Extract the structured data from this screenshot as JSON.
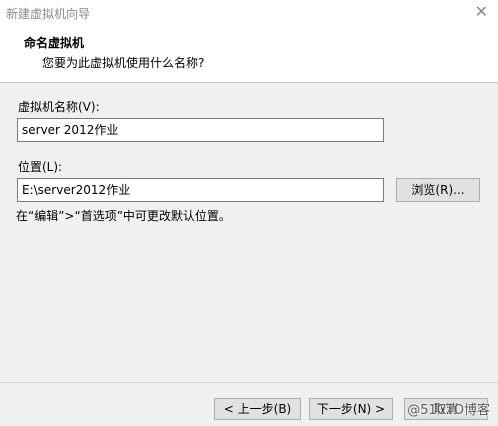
{
  "window": {
    "title": "新建虚拟机向导",
    "close_glyph": "✕"
  },
  "header": {
    "heading": "命名虚拟机",
    "subheading": "您要为此虚拟机使用什么名称?"
  },
  "vm_name": {
    "label": "虚拟机名称(V):",
    "value": "server 2012作业"
  },
  "location": {
    "label": "位置(L):",
    "value": "E:\\server2012作业",
    "browse_label": "浏览(R)..."
  },
  "hint": "在“编辑”>“首选项”中可更改默认位置。",
  "footer": {
    "back_label": "< 上一步(B)",
    "next_label": "下一步(N) >",
    "cancel_label": "取消"
  },
  "watermark": "@51CTO博客"
}
